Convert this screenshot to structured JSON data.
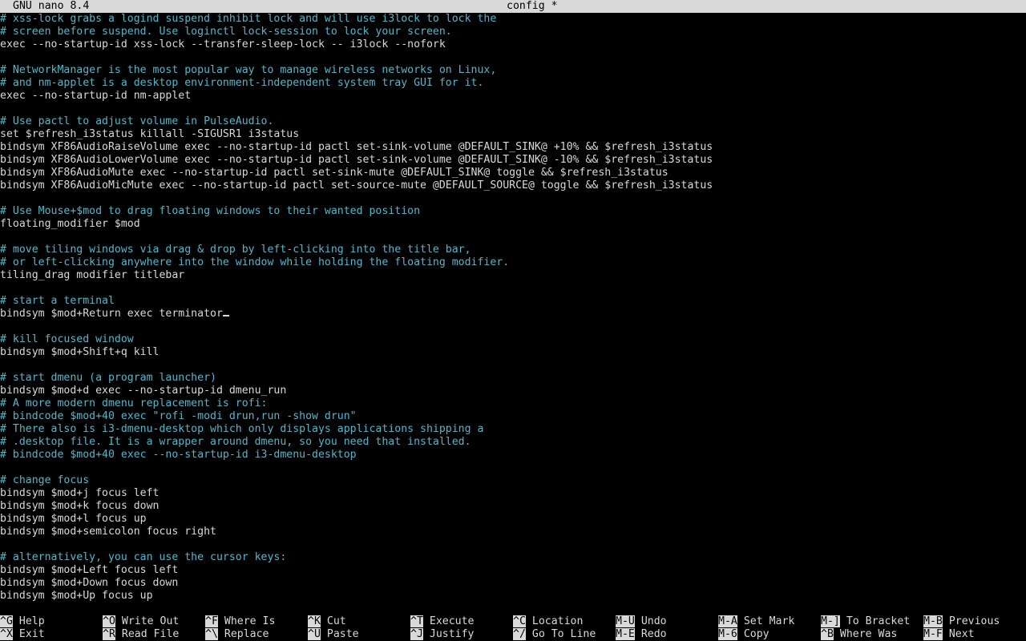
{
  "titlebar": {
    "app": "GNU nano 8.4",
    "file": "config *"
  },
  "lines": [
    {
      "type": "comment",
      "text": "# xss-lock grabs a logind suspend inhibit lock and will use i3lock to lock the"
    },
    {
      "type": "comment",
      "text": "# screen before suspend. Use loginctl lock-session to lock your screen."
    },
    {
      "type": "code",
      "text": "exec --no-startup-id xss-lock --transfer-sleep-lock -- i3lock --nofork"
    },
    {
      "type": "code",
      "text": ""
    },
    {
      "type": "comment",
      "text": "# NetworkManager is the most popular way to manage wireless networks on Linux,"
    },
    {
      "type": "comment",
      "text": "# and nm-applet is a desktop environment-independent system tray GUI for it."
    },
    {
      "type": "code",
      "text": "exec --no-startup-id nm-applet"
    },
    {
      "type": "code",
      "text": ""
    },
    {
      "type": "comment",
      "text": "# Use pactl to adjust volume in PulseAudio."
    },
    {
      "type": "code",
      "text": "set $refresh_i3status killall -SIGUSR1 i3status"
    },
    {
      "type": "code",
      "text": "bindsym XF86AudioRaiseVolume exec --no-startup-id pactl set-sink-volume @DEFAULT_SINK@ +10% && $refresh_i3status"
    },
    {
      "type": "code",
      "text": "bindsym XF86AudioLowerVolume exec --no-startup-id pactl set-sink-volume @DEFAULT_SINK@ -10% && $refresh_i3status"
    },
    {
      "type": "code",
      "text": "bindsym XF86AudioMute exec --no-startup-id pactl set-sink-mute @DEFAULT_SINK@ toggle && $refresh_i3status"
    },
    {
      "type": "code",
      "text": "bindsym XF86AudioMicMute exec --no-startup-id pactl set-source-mute @DEFAULT_SOURCE@ toggle && $refresh_i3status"
    },
    {
      "type": "code",
      "text": ""
    },
    {
      "type": "comment",
      "text": "# Use Mouse+$mod to drag floating windows to their wanted position"
    },
    {
      "type": "code",
      "text": "floating_modifier $mod"
    },
    {
      "type": "code",
      "text": ""
    },
    {
      "type": "comment",
      "text": "# move tiling windows via drag & drop by left-clicking into the title bar,"
    },
    {
      "type": "comment",
      "text": "# or left-clicking anywhere into the window while holding the floating modifier."
    },
    {
      "type": "code",
      "text": "tiling_drag modifier titlebar"
    },
    {
      "type": "code",
      "text": ""
    },
    {
      "type": "comment",
      "text": "# start a terminal"
    },
    {
      "type": "code",
      "text": "bindsym $mod+Return exec terminator",
      "cursor": true
    },
    {
      "type": "code",
      "text": ""
    },
    {
      "type": "comment",
      "text": "# kill focused window"
    },
    {
      "type": "code",
      "text": "bindsym $mod+Shift+q kill"
    },
    {
      "type": "code",
      "text": ""
    },
    {
      "type": "comment",
      "text": "# start dmenu (a program launcher)"
    },
    {
      "type": "code",
      "text": "bindsym $mod+d exec --no-startup-id dmenu_run"
    },
    {
      "type": "comment",
      "text": "# A more modern dmenu replacement is rofi:"
    },
    {
      "type": "comment",
      "text": "# bindcode $mod+40 exec \"rofi -modi drun,run -show drun\""
    },
    {
      "type": "comment",
      "text": "# There also is i3-dmenu-desktop which only displays applications shipping a"
    },
    {
      "type": "comment",
      "text": "# .desktop file. It is a wrapper around dmenu, so you need that installed."
    },
    {
      "type": "comment",
      "text": "# bindcode $mod+40 exec --no-startup-id i3-dmenu-desktop"
    },
    {
      "type": "code",
      "text": ""
    },
    {
      "type": "comment",
      "text": "# change focus"
    },
    {
      "type": "code",
      "text": "bindsym $mod+j focus left"
    },
    {
      "type": "code",
      "text": "bindsym $mod+k focus down"
    },
    {
      "type": "code",
      "text": "bindsym $mod+l focus up"
    },
    {
      "type": "code",
      "text": "bindsym $mod+semicolon focus right"
    },
    {
      "type": "code",
      "text": ""
    },
    {
      "type": "comment",
      "text": "# alternatively, you can use the cursor keys:"
    },
    {
      "type": "code",
      "text": "bindsym $mod+Left focus left"
    },
    {
      "type": "code",
      "text": "bindsym $mod+Down focus down"
    },
    {
      "type": "code",
      "text": "bindsym $mod+Up focus up"
    }
  ],
  "shortcuts": [
    {
      "key": "^G",
      "label": "Help"
    },
    {
      "key": "^X",
      "label": "Exit"
    },
    {
      "key": "^O",
      "label": "Write Out"
    },
    {
      "key": "^R",
      "label": "Read File"
    },
    {
      "key": "^F",
      "label": "Where Is"
    },
    {
      "key": "^\\",
      "label": "Replace"
    },
    {
      "key": "^K",
      "label": "Cut"
    },
    {
      "key": "^U",
      "label": "Paste"
    },
    {
      "key": "^T",
      "label": "Execute"
    },
    {
      "key": "^J",
      "label": "Justify"
    },
    {
      "key": "^C",
      "label": "Location"
    },
    {
      "key": "^/",
      "label": "Go To Line"
    },
    {
      "key": "M-U",
      "label": "Undo"
    },
    {
      "key": "M-E",
      "label": "Redo"
    },
    {
      "key": "M-A",
      "label": "Set Mark"
    },
    {
      "key": "M-6",
      "label": "Copy"
    },
    {
      "key": "M-]",
      "label": "To Bracket"
    },
    {
      "key": "^B",
      "label": "Where Was"
    },
    {
      "key": "M-B",
      "label": "Previous"
    },
    {
      "key": "M-F",
      "label": "Next"
    }
  ],
  "colors": {
    "background": "#000000",
    "text": "#d9d9d9",
    "comment": "#55b6c8",
    "bar": "#d9d9d9"
  }
}
